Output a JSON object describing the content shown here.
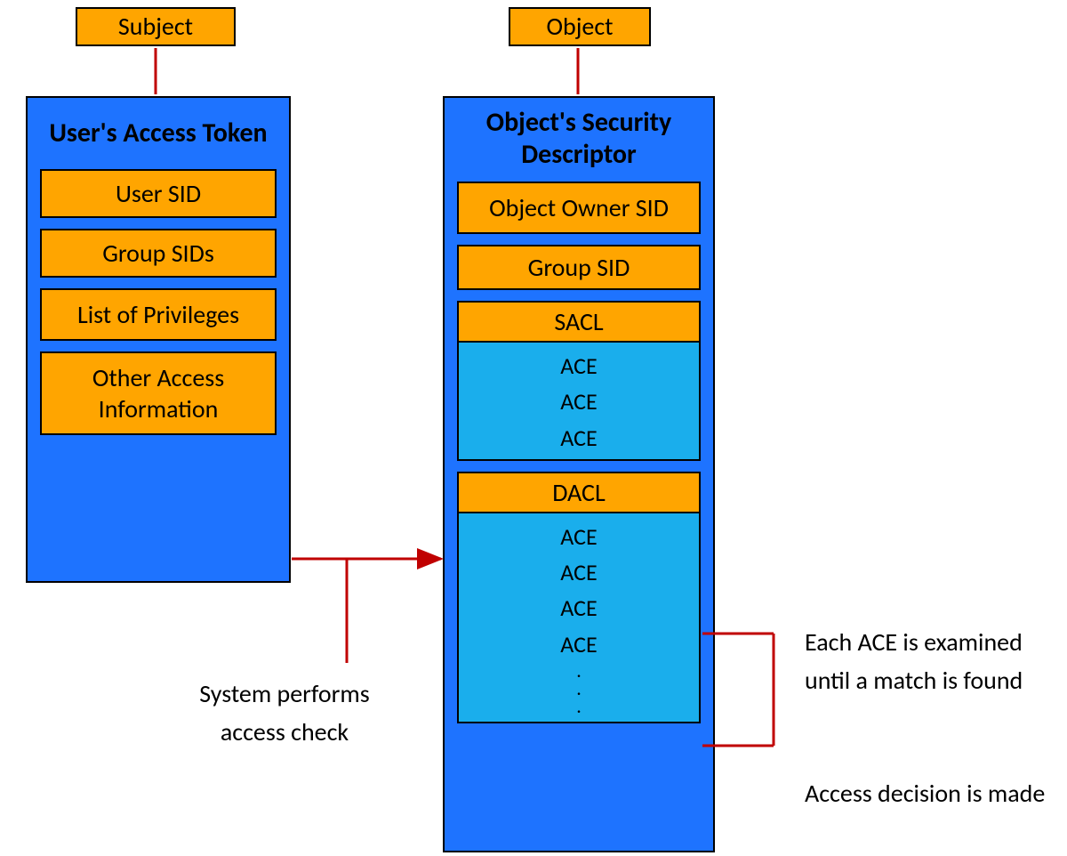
{
  "top": {
    "subject": "Subject",
    "object": "Object"
  },
  "left_box": {
    "title": "User's Access Token",
    "items": {
      "user_sid": "User SID",
      "group_sids": "Group SIDs",
      "privileges": "List of Privileges",
      "other": "Other Access Information"
    }
  },
  "right_box": {
    "title": "Object's Security Descriptor",
    "owner": "Object Owner SID",
    "group": "Group SID",
    "sacl": {
      "label": "SACL",
      "entries": [
        "ACE",
        "ACE",
        "ACE"
      ]
    },
    "dacl": {
      "label": "DACL",
      "entries": [
        "ACE",
        "ACE",
        "ACE",
        "ACE"
      ],
      "dots": [
        ".",
        ".",
        "."
      ]
    }
  },
  "captions": {
    "access_check": "System performs access check",
    "examined": "Each ACE is examined until a match is found",
    "decision": "Access decision is made"
  }
}
